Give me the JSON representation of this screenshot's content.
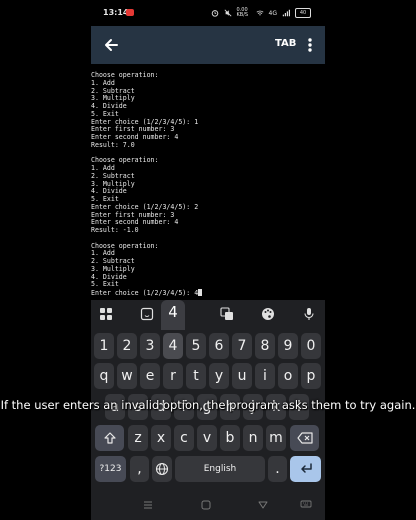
{
  "status_bar": {
    "time": "13:14",
    "speed": "0.00 KB/S",
    "network": "4G",
    "battery": "40"
  },
  "app_bar": {
    "tab_label": "TAB"
  },
  "terminal": {
    "lines": [
      "Choose operation:",
      "1. Add",
      "2. Subtract",
      "3. Multiply",
      "4. Divide",
      "5. Exit",
      "Enter choice (1/2/3/4/5): 1",
      "Enter first number: 3",
      "Enter second number: 4",
      "Result: 7.0",
      "",
      "Choose operation:",
      "1. Add",
      "2. Subtract",
      "3. Multiply",
      "4. Divide",
      "5. Exit",
      "Enter choice (1/2/3/4/5): 2",
      "Enter first number: 3",
      "Enter second number: 4",
      "Result: -1.0",
      "",
      "Choose operation:",
      "1. Add",
      "2. Subtract",
      "3. Multiply",
      "4. Divide",
      "5. Exit"
    ],
    "input_line": "Enter choice (1/2/3/4/5): 4"
  },
  "keyboard": {
    "popup_key": "4",
    "number_row": [
      "1",
      "2",
      "3",
      "4",
      "5",
      "6",
      "7",
      "8",
      "9",
      "0"
    ],
    "row_q": [
      "q",
      "w",
      "e",
      "r",
      "t",
      "y",
      "u",
      "i",
      "o",
      "p"
    ],
    "row_a": [
      "a",
      "s",
      "d",
      "f",
      "g",
      "h",
      "j",
      "k",
      "l"
    ],
    "row_z": [
      "z",
      "x",
      "c",
      "v",
      "b",
      "n",
      "m"
    ],
    "symbols_label": "?123",
    "comma_label": ",",
    "space_label": "English",
    "period_label": "."
  },
  "caption": "If the user enters an invalid option, the program asks them to try again.",
  "colors": {
    "app_bar": "#263443",
    "keyboard_bg": "#1f2023",
    "key_bg": "#36373b",
    "enter_key": "#a9c6ea"
  }
}
